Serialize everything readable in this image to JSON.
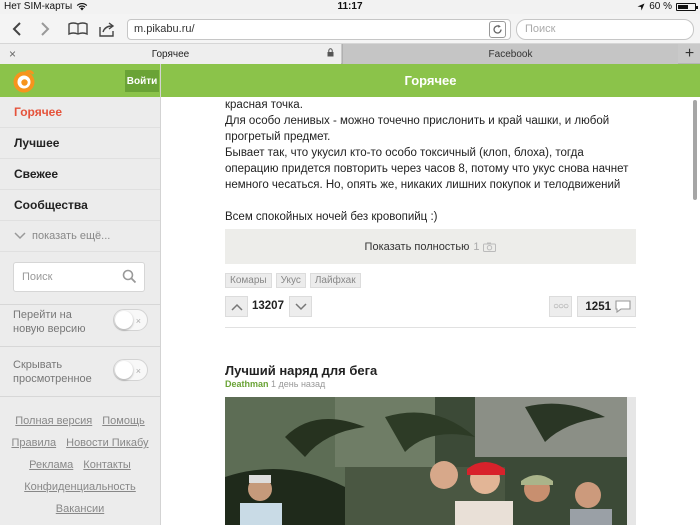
{
  "status_bar": {
    "carrier": "Нет SIM-карты",
    "time": "11:17",
    "battery": "60 %",
    "battery_level": 0.6
  },
  "browser": {
    "url": "m.pikabu.ru/",
    "search_placeholder": "Поиск",
    "tabs": [
      {
        "label": "Горячее"
      },
      {
        "label": "Facebook"
      }
    ]
  },
  "sidebar": {
    "login_label": "Войти",
    "nav": [
      {
        "label": "Горячее"
      },
      {
        "label": "Лучшее"
      },
      {
        "label": "Свежее"
      },
      {
        "label": "Сообщества"
      }
    ],
    "show_more": "показать ещё...",
    "search_placeholder": "Поиск",
    "toggles": [
      {
        "label": "Перейти на новую версию",
        "on": false
      },
      {
        "label": "Скрывать просмотренное",
        "on": false
      }
    ],
    "footer_links": [
      [
        "Полная версия",
        "Помощь"
      ],
      [
        "Правила",
        "Новости Пикабу"
      ],
      [
        "Реклама",
        "Контакты"
      ],
      [
        "Конфиденциальность"
      ],
      [
        "Вакансии"
      ]
    ]
  },
  "main": {
    "title": "Горячее",
    "post": {
      "paragraphs": [
        "красная точка.",
        "Для особо ленивых - можно точечно прислонить и край чашки, и любой прогретый предмет.",
        "Бывает так, что укусил кто-то особо токсичный (клоп, блоха), тогда операцию придется повторить через часов 8, потому что укус снова начнет немного чесаться. Но, опять же, никаких лишних покупок и телодвижений",
        "",
        "Всем спокойных ночей без кровопийц :)"
      ],
      "show_full_label": "Показать полностью",
      "show_full_count": "1",
      "tags": [
        "Комары",
        "Укус",
        "Лайфхак"
      ],
      "rating": "13207",
      "comments": "1251"
    },
    "post2": {
      "title": "Лучший наряд для бега",
      "author": "Deathman",
      "time": "1 день назад"
    }
  },
  "colors": {
    "brand_green": "#8bc34a",
    "active_red": "#e5533b",
    "author_green": "#6aa336"
  }
}
